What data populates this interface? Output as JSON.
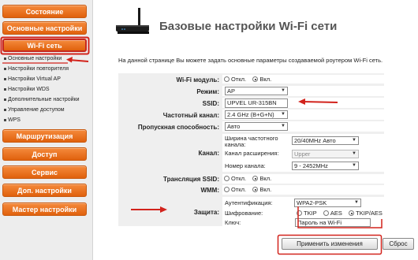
{
  "sidebar": {
    "items": [
      {
        "label": "Состояние"
      },
      {
        "label": "Основные настройки"
      },
      {
        "label": "Wi-Fi сеть"
      },
      {
        "label": "Маршрутизация"
      },
      {
        "label": "Доступ"
      },
      {
        "label": "Сервис"
      },
      {
        "label": "Доп. настройки"
      },
      {
        "label": "Мастер настройки"
      }
    ],
    "active_item": "Wi-Fi сеть",
    "subitems": [
      {
        "label": "Основные настройки"
      },
      {
        "label": "Настройки повторителя"
      },
      {
        "label": "Настройки Virtual AP"
      },
      {
        "label": "Настройки WDS"
      },
      {
        "label": "Дополнительные настройки"
      },
      {
        "label": "Управление доступом"
      },
      {
        "label": "WPS"
      }
    ]
  },
  "header": {
    "title": "Базовые настройки Wi-Fi сети",
    "description": "На данной странице Вы можете задать основные параметры создаваемой роутером Wi-Fi сеть."
  },
  "form": {
    "wifi_module": {
      "label": "Wi-Fi модуль:",
      "options": [
        "Откл.",
        "Вкл."
      ],
      "selected": "Вкл."
    },
    "mode": {
      "label": "Режим:",
      "value": "AP"
    },
    "ssid": {
      "label": "SSID:",
      "value": "UPVEL UR-315BN"
    },
    "band": {
      "label": "Частотный канал:",
      "value": "2.4 GHz (B+G+N)"
    },
    "bandwidth": {
      "label": "Пропускная способность:",
      "value": "Авто"
    },
    "channel": {
      "label": "Канал:",
      "width_label": "Ширина частотного канала:",
      "width_value": "20/40MHz Авто",
      "ext_label": "Канал расширения:",
      "ext_value": "Upper",
      "number_label": "Номер канала:",
      "number_value": "9 - 2452MHz"
    },
    "ssid_broadcast": {
      "label": "Трансляция SSID:",
      "options": [
        "Откл.",
        "Вкл."
      ],
      "selected": "Вкл."
    },
    "wmm": {
      "label": "WMM:",
      "options": [
        "Откл.",
        "Вкл."
      ],
      "selected": "Вкл."
    },
    "security": {
      "label": "Защита:",
      "auth_label": "Аутентификация:",
      "auth_value": "WPA2-PSK",
      "enc_label": "Шифрование:",
      "enc_options": [
        "TKIP",
        "AES",
        "TKIP/AES"
      ],
      "enc_selected": "TKIP/AES",
      "key_label": "Ключ:",
      "key_value": "Пароль на Wi-Fi"
    }
  },
  "buttons": {
    "apply": "Применить изменения",
    "reset": "Сброс"
  },
  "colors": {
    "nav_orange": "#e96a16",
    "annotation_red": "#d2231c",
    "form_bg": "#efefef"
  }
}
